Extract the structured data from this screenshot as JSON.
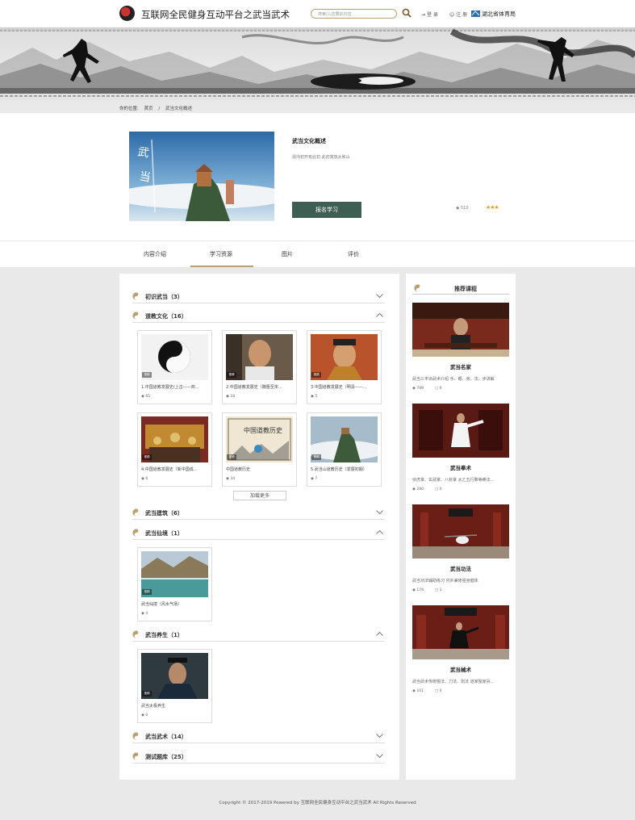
{
  "header": {
    "site_title": "互联网全民健身互动平台之武当武术",
    "search_placeholder": "搜索/入您要的内容",
    "login": "登 录",
    "register": "注 册",
    "brand": "湖北省体育局"
  },
  "breadcrumb": {
    "label": "你的位置:",
    "home": "首页",
    "sep": "/",
    "current": "武当文化概述"
  },
  "course": {
    "title": "武当文化概述",
    "subtitle": "混沌初开有此初 此初简放太和山",
    "enroll_label": "报名学习",
    "views": "510",
    "stars": "★★★"
  },
  "tabs": [
    {
      "label": "内容介绍"
    },
    {
      "label": "学习资源"
    },
    {
      "label": "图片"
    },
    {
      "label": "评价"
    }
  ],
  "sections": [
    {
      "title": "初识武当",
      "count": "（3）"
    },
    {
      "title": "道教文化",
      "count": "（16）"
    },
    {
      "title": "武当建筑",
      "count": "（6）"
    },
    {
      "title": "武当仙境",
      "count": "（1）"
    },
    {
      "title": "武当养生",
      "count": "（1）"
    },
    {
      "title": "武当武术",
      "count": "（14）"
    },
    {
      "title": "测试题库",
      "count": "（25）"
    }
  ],
  "taoism_cards": [
    {
      "title": "1.中国道教发展史(上古——商…",
      "views": "65",
      "tag": "视频"
    },
    {
      "title": "2.中国道教发展史（魏晋至宋…",
      "views": "18",
      "tag": "视频"
    },
    {
      "title": "3.中国道教发展史（明清——…",
      "views": "5",
      "tag": "视频"
    },
    {
      "title": "4.中国道教发展史（新中国成…",
      "views": "6",
      "tag": "视频"
    },
    {
      "title": "中国道教历史",
      "views": "34",
      "tag": "视频"
    },
    {
      "title": "5.武当山道教历史（发展初期）",
      "views": "7",
      "tag": "视频"
    }
  ],
  "more_label": "加载更多",
  "wonderland_cards": [
    {
      "title": "武当仙境（风水气场）",
      "views": "4",
      "tag": "视频"
    }
  ],
  "health_cards": [
    {
      "title": "武当太极养生",
      "views": "0",
      "tag": "视频"
    }
  ],
  "sidebar": {
    "heading": "推荐课程",
    "items": [
      {
        "title": "武当名家",
        "desc": "武当三丰派武术介绍 手、眼、身、法、步讲解",
        "views": "798",
        "comments": "0"
      },
      {
        "title": "武当拳术",
        "desc": "伏虎掌、玄武掌、八卦掌 太乙五行擎等拳法…",
        "views": "280",
        "comments": "0"
      },
      {
        "title": "武当功法",
        "desc": "武当功法辅助练习 内外兼修强身健体",
        "views": "178",
        "comments": "1"
      },
      {
        "title": "武当械术",
        "desc": "武当武术传统棍法、刀法、剑法 道家独家兵…",
        "views": "101",
        "comments": "0"
      }
    ]
  },
  "footer": "Copyright © 2017-2019 Powered by 互联网全民健身互动平台之武当武术 All Rights Reserved",
  "colors": {
    "accent": "#b8a071",
    "button": "#3e5e53",
    "star": "#e0a020"
  }
}
